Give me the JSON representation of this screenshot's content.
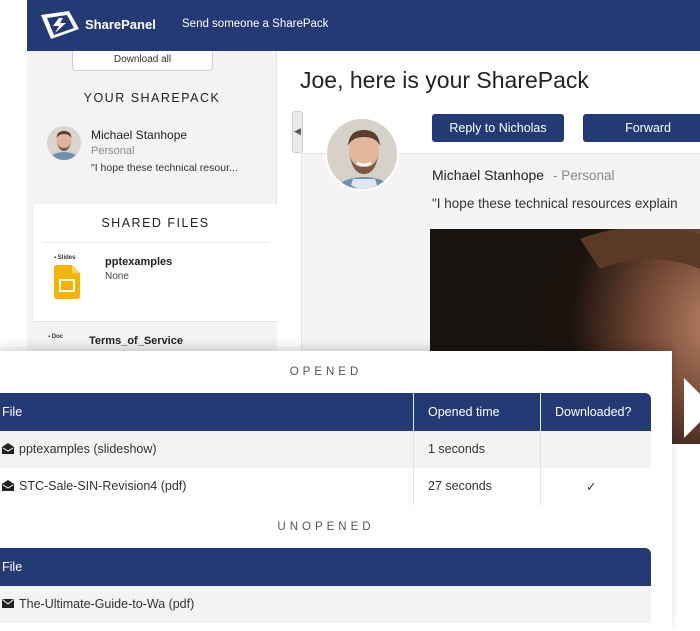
{
  "header": {
    "brand": "SharePanel",
    "send_link": "Send someone a SharePack"
  },
  "sidebar": {
    "download_all": "Download all",
    "your_sharepack_heading": "YOUR SHAREPACK",
    "sender": {
      "name": "Michael Stanhope",
      "type": "Personal",
      "message_preview": "\"I hope these technical resour..."
    },
    "shared_files_heading": "SHARED FILES",
    "files": [
      {
        "tag": "Slides",
        "name": "pptexamples",
        "subtitle": "None"
      },
      {
        "tag": "Doc",
        "name": "Terms_of_Service"
      }
    ]
  },
  "main": {
    "title": "Joe, here is your SharePack",
    "reply_button": "Reply to Nicholas",
    "forward_button": "Forward",
    "message": {
      "sender_name": "Michael Stanhope",
      "sender_type": "- Personal",
      "text": "\"I hope these technical resources explain"
    }
  },
  "stats": {
    "opened_label": "OPENED",
    "opened_columns": [
      "File",
      "Opened time",
      "Downloaded?"
    ],
    "opened_rows": [
      {
        "file": "pptexamples (slideshow)",
        "opened_time": "1 seconds",
        "downloaded": ""
      },
      {
        "file": "STC-Sale-SIN-Revision4 (pdf)",
        "opened_time": "27 seconds",
        "downloaded": "✓"
      }
    ],
    "unopened_label": "UNOPENED",
    "unopened_columns": [
      "File"
    ],
    "unopened_rows": [
      {
        "file": "The-Ultimate-Guide-to-Wa (pdf)"
      }
    ]
  },
  "colors": {
    "brand_navy": "#243a74",
    "slides_yellow": "#f4b400"
  },
  "icons": {
    "logo": "sharepanel-logo-icon",
    "opened_file": "open-envelope-icon",
    "unopened_file": "closed-envelope-icon",
    "play": "play-icon",
    "collapse": "chevron-left-icon"
  }
}
